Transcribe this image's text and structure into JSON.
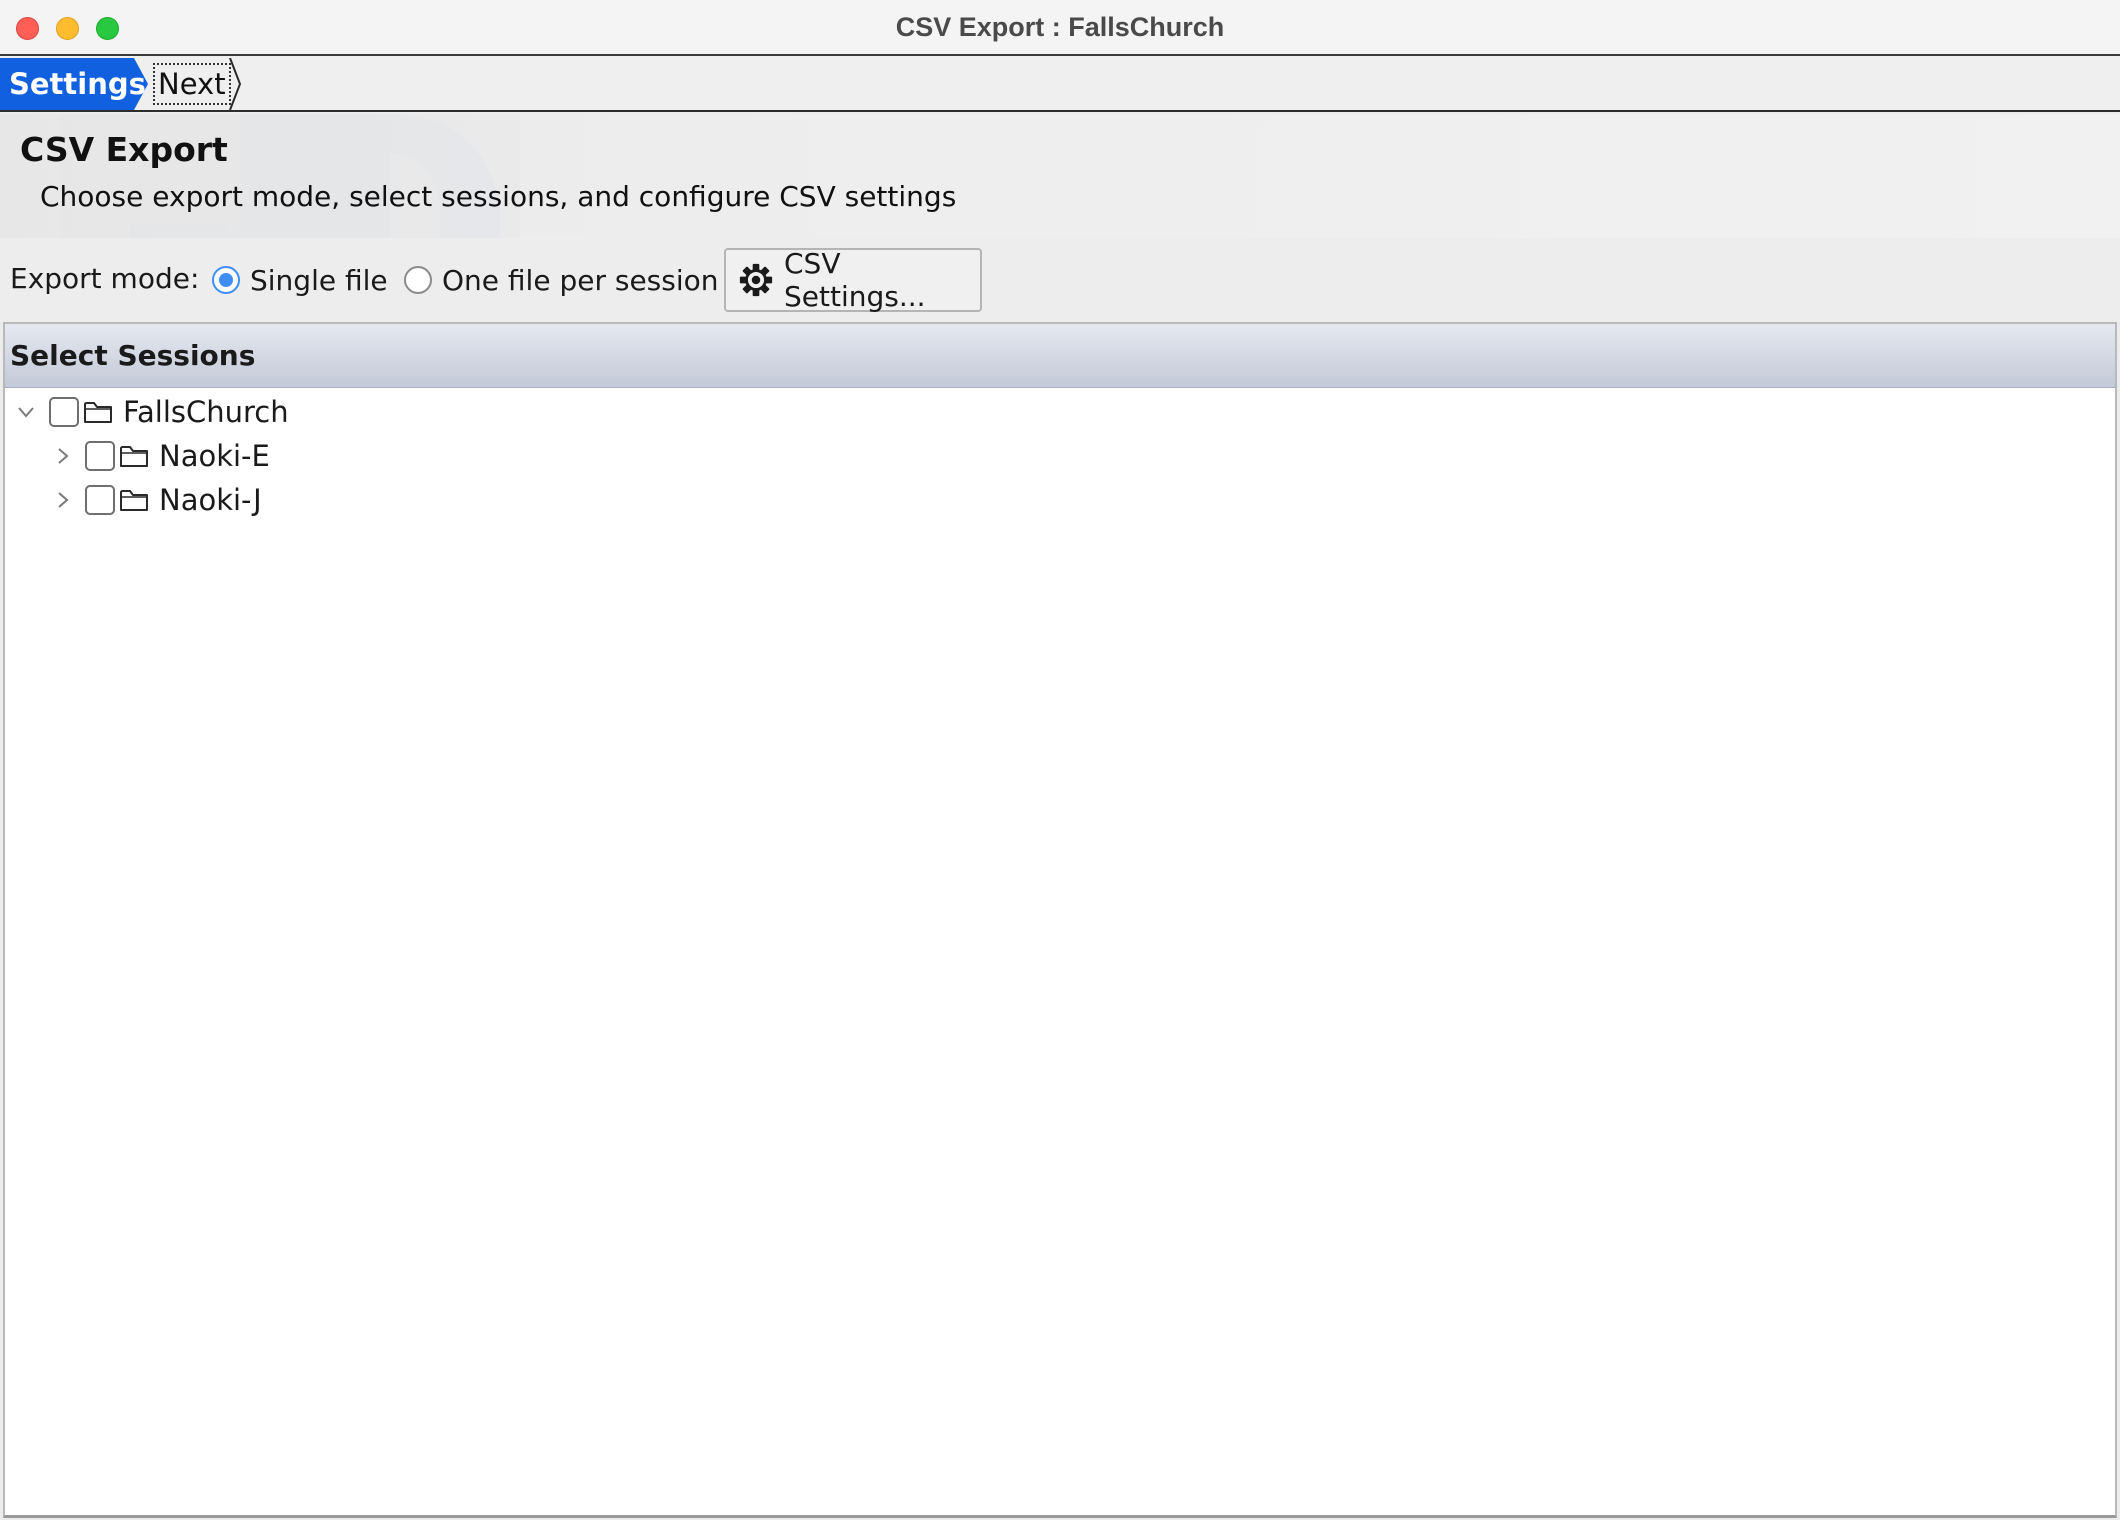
{
  "window": {
    "title": "CSV Export : FallsChurch"
  },
  "breadcrumb": {
    "current": "Settings",
    "next": "Next"
  },
  "header": {
    "title": "CSV Export",
    "subtitle": "Choose export mode, select sessions, and configure CSV settings"
  },
  "export_mode": {
    "label": "Export mode:",
    "options": [
      {
        "label": "Single file",
        "selected": true
      },
      {
        "label": "One file per session",
        "selected": false
      }
    ],
    "settings_button": "CSV Settings..."
  },
  "sessions": {
    "title": "Select Sessions",
    "tree": [
      {
        "label": "FallsChurch",
        "expanded": true,
        "checked": false,
        "icon": "folder-icon",
        "toggle_icon": "chevron-down-icon"
      },
      {
        "label": "Naoki-E",
        "expanded": false,
        "checked": false,
        "icon": "folder-icon",
        "toggle_icon": "chevron-right-icon"
      },
      {
        "label": "Naoki-J",
        "expanded": false,
        "checked": false,
        "icon": "folder-icon",
        "toggle_icon": "chevron-right-icon"
      }
    ]
  },
  "colors": {
    "accent": "#1060e0",
    "radio_selected": "#3e8ef7",
    "close": "#ff5f57",
    "minimize": "#febc2e",
    "maximize": "#28c840"
  }
}
